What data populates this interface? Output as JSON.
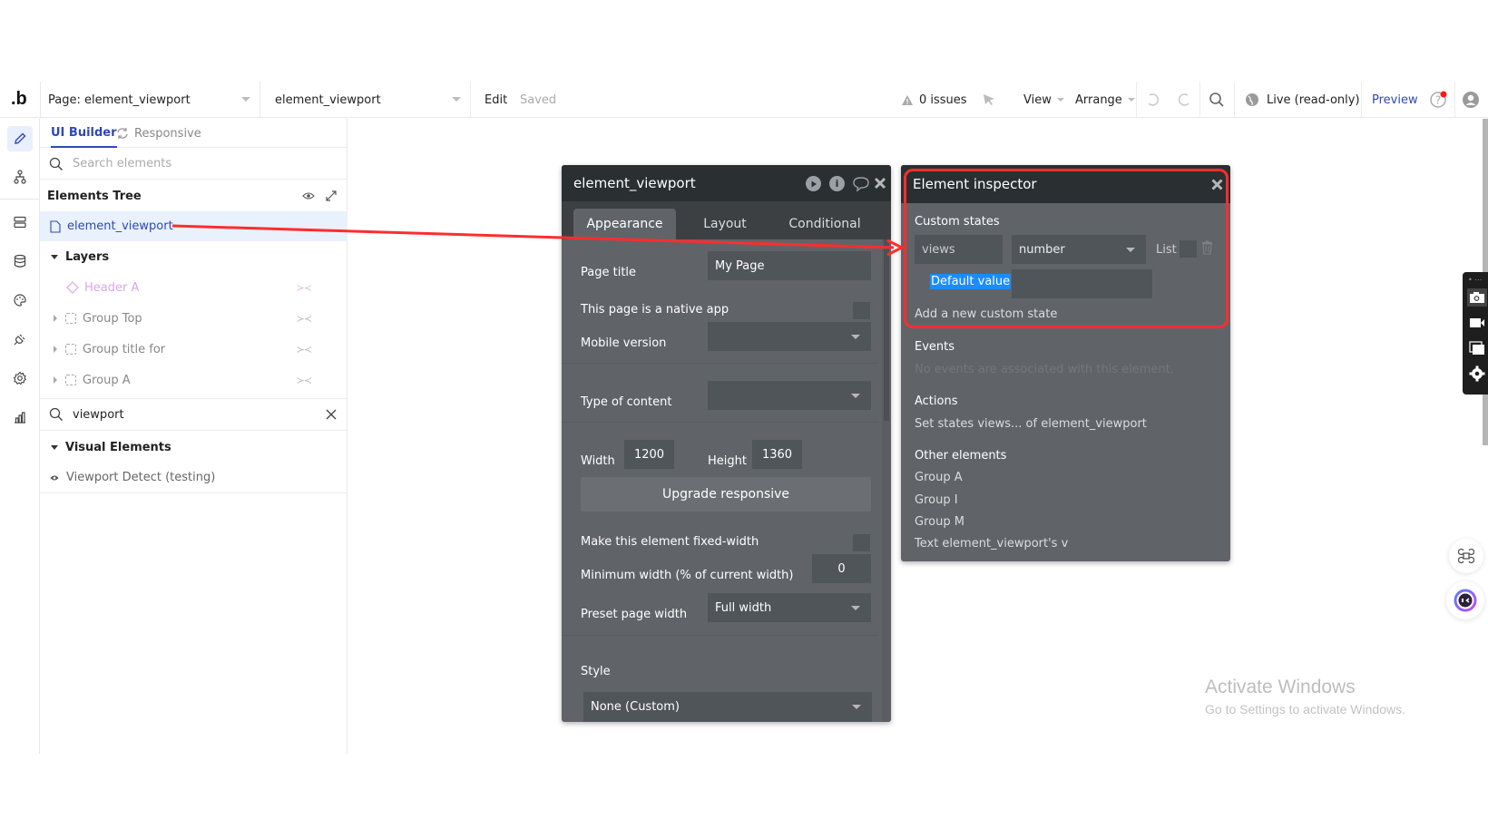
{
  "topbar": {
    "logo": ".b",
    "page_selector": "Page: element_viewport",
    "element_selector": "element_viewport",
    "edit_label": "Edit",
    "saved_label": "Saved",
    "issues_label": "0 issues",
    "view_label": "View",
    "arrange_label": "Arrange",
    "live_label": "Live (read-only)",
    "preview_label": "Preview",
    "accent_color": "#2e48b8"
  },
  "rail": {
    "items": [
      "design",
      "workflow",
      "data",
      "database",
      "styles",
      "plugins",
      "settings",
      "logs"
    ]
  },
  "left_panel": {
    "tabs": [
      {
        "label": "UI Builder",
        "active": true
      },
      {
        "label": "Responsive",
        "active": false
      }
    ],
    "search_placeholder": "Search elements",
    "tree_title": "Elements Tree",
    "root_element": "element_viewport",
    "layers_title": "Layers",
    "layers": [
      {
        "label": "Header A",
        "type": "reusable",
        "hidden": true
      },
      {
        "label": "Group Top",
        "type": "group",
        "hidden": true
      },
      {
        "label": "Group title for",
        "type": "group",
        "hidden": true
      },
      {
        "label": "Group A",
        "type": "group",
        "hidden": true
      }
    ],
    "filter_value": "viewport",
    "visual_title": "Visual Elements",
    "visual_items": [
      {
        "label": "Viewport Detect (testing)"
      }
    ]
  },
  "editor": {
    "title": "element_viewport",
    "tabs": [
      {
        "label": "Appearance",
        "active": true
      },
      {
        "label": "Layout",
        "active": false
      },
      {
        "label": "Conditional",
        "active": false
      }
    ],
    "page_title_label": "Page title",
    "page_title_value": "My Page",
    "native_app_label": "This page is a native app",
    "native_app_checked": false,
    "mobile_version_label": "Mobile version",
    "mobile_version_value": "",
    "type_of_content_label": "Type of content",
    "type_of_content_value": "",
    "width_label": "Width",
    "width_value": "1200",
    "height_label": "Height",
    "height_value": "1360",
    "upgrade_button": "Upgrade responsive",
    "fixed_width_label": "Make this element fixed-width",
    "fixed_width_checked": false,
    "min_width_label": "Minimum width (% of current width)",
    "min_width_value": "0",
    "preset_width_label": "Preset page width",
    "preset_width_value": "Full width",
    "style_label": "Style",
    "style_value": "None (Custom)"
  },
  "inspector": {
    "title": "Element inspector",
    "custom_states_label": "Custom states",
    "state_name": "views",
    "state_type": "number",
    "list_label": "List",
    "list_checked": false,
    "default_value_label": "Default value",
    "default_value": "",
    "add_state_label": "Add a new custom state",
    "events_label": "Events",
    "events_empty": "No events are associated with this element.",
    "actions_label": "Actions",
    "actions": [
      "Set states views... of element_viewport"
    ],
    "other_elements_label": "Other elements",
    "other_elements": [
      "Group A",
      "Group I",
      "Group M",
      "Text element_viewport's v"
    ]
  },
  "annotation": {
    "color": "#ff2d2d",
    "from": "element_viewport",
    "to": "Custom states"
  },
  "watermark": {
    "title": "Activate Windows",
    "subtitle": "Go to Settings to activate Windows."
  }
}
